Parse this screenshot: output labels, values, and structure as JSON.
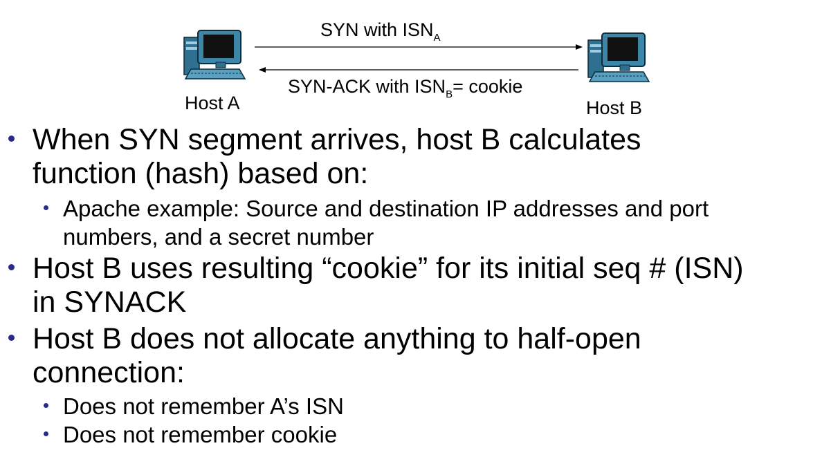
{
  "diagram": {
    "host_a_label": "Host A",
    "host_b_label": "Host B",
    "syn_prefix": "SYN with ISN",
    "syn_sub": "A",
    "synack_prefix": "SYN-ACK with ISN",
    "synack_sub": "B",
    "synack_suffix": "= cookie",
    "computer_icon": "desktop-computer-icon"
  },
  "bullets": [
    {
      "level": 1,
      "lines": [
        "When SYN segment arrives, host B calculates",
        "function (hash) based on:"
      ]
    },
    {
      "level": 2,
      "lines": [
        "Apache example: Source and destination IP addresses and port",
        "numbers, and a secret number"
      ]
    },
    {
      "level": 1,
      "lines": [
        "Host B uses resulting “cookie” for its initial seq # (ISN)",
        "in SYNACK"
      ]
    },
    {
      "level": 1,
      "lines": [
        "Host B does not allocate anything to half-open",
        "connection:"
      ]
    },
    {
      "level": 2,
      "lines": [
        "Does not remember A’s ISN"
      ]
    },
    {
      "level": 2,
      "lines": [
        "Does not remember cookie"
      ]
    }
  ],
  "colors": {
    "bullet": "#2a2a8a",
    "monitor_frame": "#2f6f8f",
    "screen": "#111111",
    "text": "#000000"
  }
}
